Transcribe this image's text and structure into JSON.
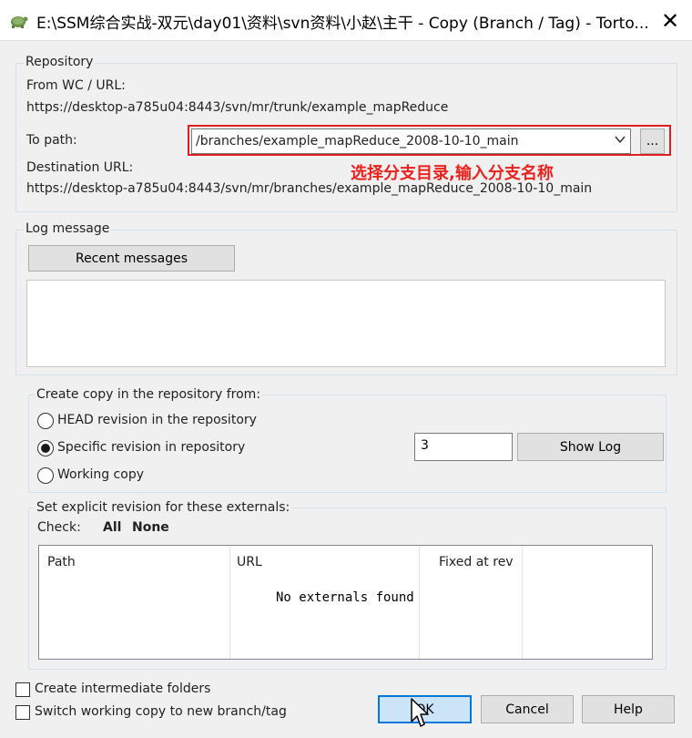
{
  "window": {
    "title": "E:\\SSM综合实战-双元\\day01\\资料\\svn资料\\小赵\\主干 - Copy (Branch / Tag) - Torto...",
    "close_glyph": "✕"
  },
  "repository": {
    "group_label": "Repository",
    "from_label": "From WC / URL:",
    "from_url": "https://desktop-a785u04:8443/svn/mr/trunk/example_mapReduce",
    "to_path_label": "To path:",
    "to_path_value": "/branches/example_mapReduce_2008-10-10_main",
    "browse_label": "...",
    "dest_label": "Destination URL:",
    "dest_url": "https://desktop-a785u04:8443/svn/mr/branches/example_mapReduce_2008-10-10_main"
  },
  "annotation": {
    "text": "选择分支目录,输入分支名称",
    "color": "#e8231e"
  },
  "log": {
    "group_label": "Log message",
    "recent_button": "Recent messages",
    "message": ""
  },
  "copy_from": {
    "group_label": "Create copy in the repository from:",
    "options": [
      {
        "label": "HEAD revision in the repository",
        "selected": false
      },
      {
        "label": "Specific revision in repository",
        "selected": true
      },
      {
        "label": "Working copy",
        "selected": false
      }
    ],
    "revision_value": "3",
    "show_log_button": "Show Log"
  },
  "externals": {
    "group_label": "Set explicit revision for these externals:",
    "check_label": "Check:",
    "all_label": "All",
    "none_label": "None",
    "columns": [
      "Path",
      "URL",
      "Fixed at rev"
    ],
    "empty_message": "No externals found"
  },
  "options": {
    "intermediate_folders": {
      "label": "Create intermediate folders",
      "checked": false
    },
    "switch_wc": {
      "label": "Switch working copy to new branch/tag",
      "checked": false
    }
  },
  "buttons": {
    "ok": "OK",
    "cancel": "Cancel",
    "help": "Help"
  },
  "icons": {
    "app": "tortoise-icon",
    "cursor": "mouse-pointer-icon",
    "dropdown": "chevron-down-icon"
  }
}
